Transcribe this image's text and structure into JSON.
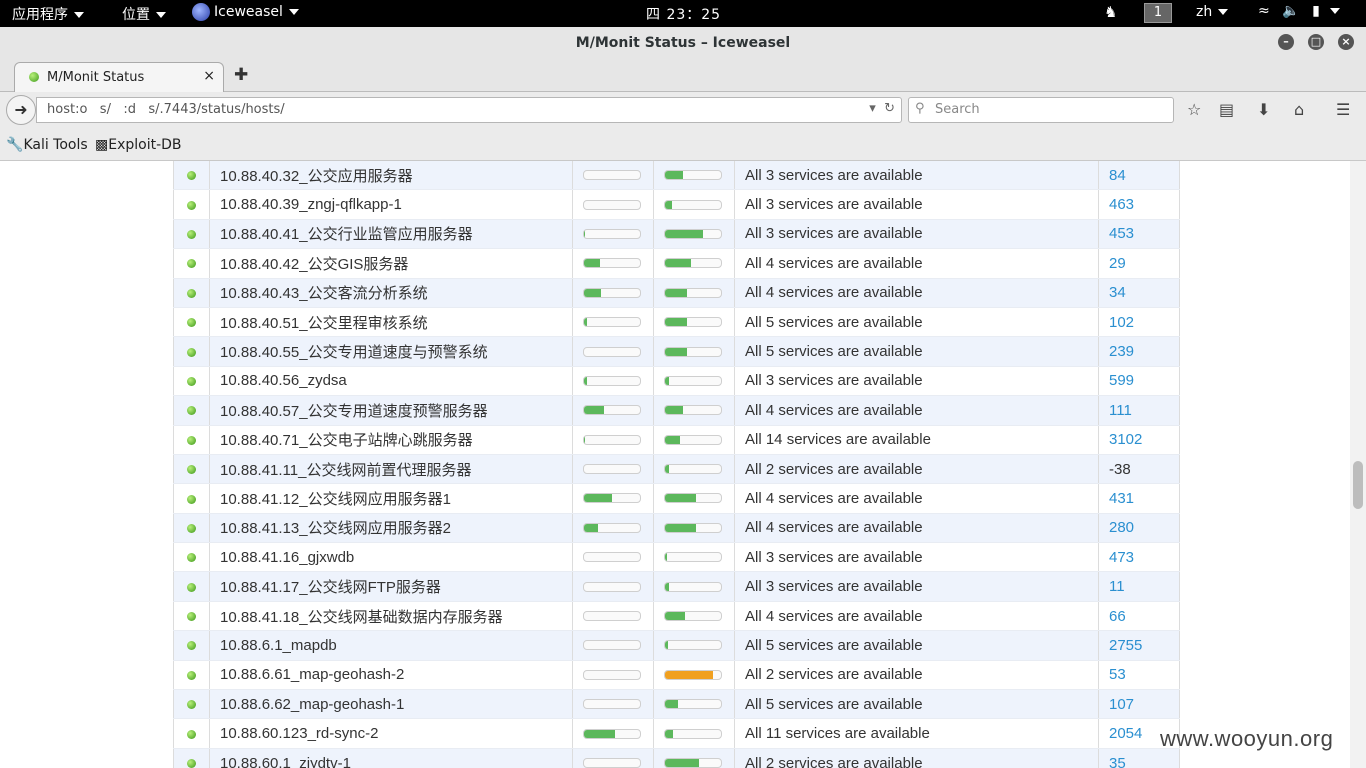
{
  "top_panel": {
    "applications_label": "应用程序",
    "places_label": "位置",
    "app_label": "Iceweasel",
    "clock": "四 23：25",
    "workspace": "1",
    "language": "zh"
  },
  "window": {
    "title": "M/Monit Status – Iceweasel"
  },
  "tab": {
    "label": "M/Monit Status",
    "close_label": "×"
  },
  "navbar": {
    "url": "host:o   s/   :d   s/.7443/status/hosts/",
    "search_placeholder": "Search"
  },
  "bookmarks": [
    {
      "label": "Kali Tools"
    },
    {
      "label": "Exploit-DB"
    }
  ],
  "hosts": [
    {
      "name": "10.88.40.32_公交应用服务器",
      "cpu": 0,
      "mem": 33,
      "status": "All 3 services are available",
      "events": "84"
    },
    {
      "name": "10.88.40.39_zngj-qflkapp-1",
      "cpu": 0,
      "mem": 12,
      "status": "All 3 services are available",
      "events": "463"
    },
    {
      "name": "10.88.40.41_公交行业监管应用服务器",
      "cpu": 2,
      "mem": 68,
      "status": "All 3 services are available",
      "events": "453"
    },
    {
      "name": "10.88.40.42_公交GIS服务器",
      "cpu": 28,
      "mem": 46,
      "status": "All 4 services are available",
      "events": "29"
    },
    {
      "name": "10.88.40.43_公交客流分析系统",
      "cpu": 30,
      "mem": 40,
      "status": "All 4 services are available",
      "events": "34"
    },
    {
      "name": "10.88.40.51_公交里程审核系统",
      "cpu": 6,
      "mem": 40,
      "status": "All 5 services are available",
      "events": "102"
    },
    {
      "name": "10.88.40.55_公交专用道速度与预警系统",
      "cpu": 0,
      "mem": 40,
      "status": "All 5 services are available",
      "events": "239"
    },
    {
      "name": "10.88.40.56_zydsa",
      "cpu": 5,
      "mem": 8,
      "status": "All 3 services are available",
      "events": "599"
    },
    {
      "name": "10.88.40.57_公交专用道速度预警服务器",
      "cpu": 36,
      "mem": 32,
      "status": "All 4 services are available",
      "events": "111"
    },
    {
      "name": "10.88.40.71_公交电子站牌心跳服务器",
      "cpu": 2,
      "mem": 27,
      "status": "All 14 services are available",
      "events": "3102"
    },
    {
      "name": "10.88.41.11_公交线网前置代理服务器",
      "cpu": 0,
      "mem": 8,
      "status": "All 2 services are available",
      "events": "-38"
    },
    {
      "name": "10.88.41.12_公交线网应用服务器1",
      "cpu": 50,
      "mem": 55,
      "status": "All 4 services are available",
      "events": "431"
    },
    {
      "name": "10.88.41.13_公交线网应用服务器2",
      "cpu": 25,
      "mem": 55,
      "status": "All 4 services are available",
      "events": "280"
    },
    {
      "name": "10.88.41.16_gjxwdb",
      "cpu": 0,
      "mem": 4,
      "status": "All 3 services are available",
      "events": "473"
    },
    {
      "name": "10.88.41.17_公交线网FTP服务器",
      "cpu": 0,
      "mem": 8,
      "status": "All 3 services are available",
      "events": "11"
    },
    {
      "name": "10.88.41.18_公交线网基础数据内存服务器",
      "cpu": 0,
      "mem": 35,
      "status": "All 4 services are available",
      "events": "66"
    },
    {
      "name": "10.88.6.1_mapdb",
      "cpu": 0,
      "mem": 5,
      "status": "All 5 services are available",
      "events": "2755"
    },
    {
      "name": "10.88.6.61_map-geohash-2",
      "cpu": 0,
      "mem": 86,
      "status": "All 2 services are available",
      "events": "53",
      "mem_warn": true
    },
    {
      "name": "10.88.6.62_map-geohash-1",
      "cpu": 0,
      "mem": 24,
      "status": "All 5 services are available",
      "events": "107"
    },
    {
      "name": "10.88.60.123_rd-sync-2",
      "cpu": 55,
      "mem": 15,
      "status": "All 11 services are available",
      "events": "2054"
    },
    {
      "name": "10.88.60.1_zjydtv-1",
      "cpu": 0,
      "mem": 60,
      "status": "All 2 services are available",
      "events": "35"
    }
  ],
  "watermark": "www.wooyun.org"
}
